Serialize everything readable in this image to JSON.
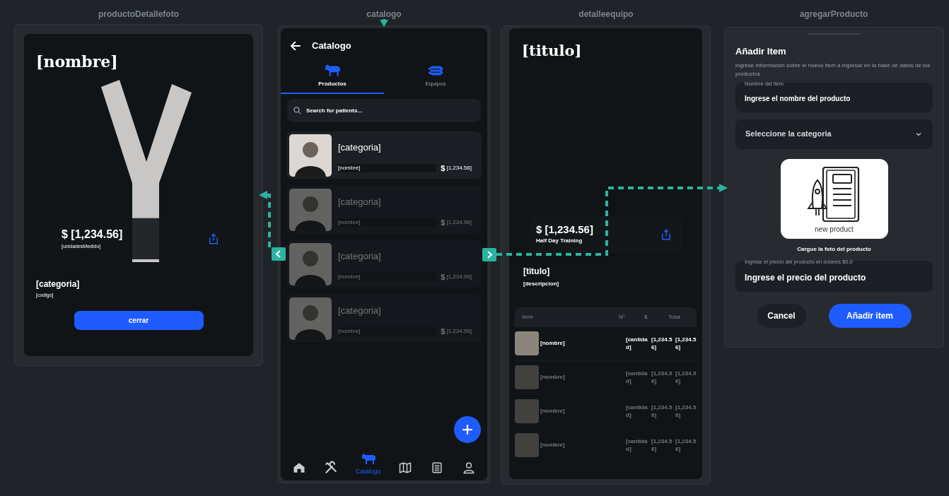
{
  "producto_detalle_foto": {
    "label": "productoDetallefoto",
    "title": "[nombre]",
    "price": "$ [1,234.56]",
    "unit": "[unidadesMedido]",
    "category": "[categoria]",
    "code": "[codigo]",
    "button": "cerrar"
  },
  "catalogo": {
    "label": "catalogo",
    "header": "Catalogo",
    "tabs": [
      {
        "label": "Productos",
        "kind": "cow",
        "selected": true
      },
      {
        "label": "Equipos",
        "kind": "machine",
        "selected": false
      }
    ],
    "search": {
      "placeholder": "Search for patients..."
    },
    "products": [
      {
        "category": "[categoria]",
        "name": "[nombre]",
        "currency": "$",
        "price": "[1,234.56]",
        "faded": false
      },
      {
        "category": "[categoria]",
        "name": "[nombre]",
        "currency": "$",
        "price": "[1,234.56]",
        "faded": true
      },
      {
        "category": "[categoria]",
        "name": "[nombre]",
        "currency": "$",
        "price": "[1,234.56]",
        "faded": true
      },
      {
        "category": "[categoria]",
        "name": "[nombre]",
        "currency": "$",
        "price": "[1,234.56]",
        "faded": true
      }
    ],
    "nav": [
      {
        "kind": "home",
        "selected": false
      },
      {
        "kind": "tools",
        "selected": false
      },
      {
        "kind": "cow",
        "label": "Catalogo",
        "selected": true
      },
      {
        "kind": "map",
        "selected": false
      },
      {
        "kind": "list",
        "selected": false
      },
      {
        "kind": "person",
        "selected": false
      }
    ]
  },
  "detalle_equipo": {
    "label": "detalleequipo",
    "title": "[titulo]",
    "price": "$ [1,234.56]",
    "price_caption": "Half Day Training",
    "subtitle": "[titulo]",
    "description": "[descripcion]",
    "table": {
      "columns": [
        "Item",
        "N°",
        "$",
        "Total"
      ],
      "rows": [
        {
          "name": "[nombre]",
          "quantity": "[cantidad]",
          "price": "[1,234.56]",
          "total": "[1,234.56]",
          "faded": false
        },
        {
          "name": "[nombre]",
          "quantity": "[cantidad]",
          "price": "[1,234.56]",
          "total": "[1,234.56]",
          "faded": true
        },
        {
          "name": "[nombre]",
          "quantity": "[cantidad]",
          "price": "[1,234.56]",
          "total": "[1,234.56]",
          "faded": true
        },
        {
          "name": "[nombre]",
          "quantity": "[cantidad]",
          "price": "[1,234.56]",
          "total": "[1,234.56]",
          "faded": true
        }
      ]
    }
  },
  "agregar_producto": {
    "label": "agregarProducto",
    "title": "Añadir Item",
    "description": "ingrese informacion  sobre el nuevo item a ingresar en la base de datos de los productos",
    "name_field": {
      "label": "Nombre del item",
      "placeholder": "Ingrese el nombre del producto"
    },
    "category_dropdown": {
      "placeholder": "Seleccione la categoria"
    },
    "image_caption": "new product",
    "upload_hint": "Cargue la foto del producto",
    "price_field": {
      "label": "Ingrese el precio del producto  en dolares $0.0",
      "placeholder": "Ingrese el precio del producto"
    },
    "buttons": [
      {
        "label": "Cancel",
        "kind": "secondary"
      },
      {
        "label": "Añadir item",
        "kind": "primary"
      }
    ]
  }
}
